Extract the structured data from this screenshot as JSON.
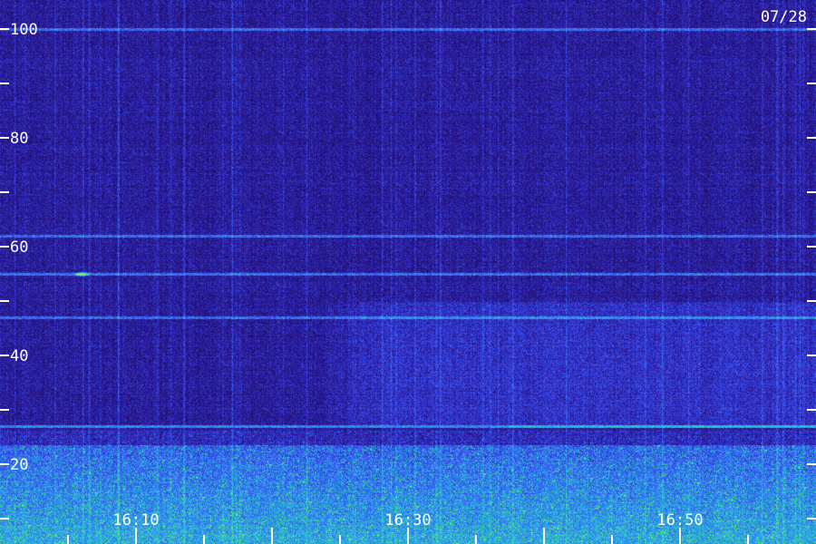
{
  "chart_data": {
    "type": "heatmap",
    "title": "",
    "date_label": "07/28",
    "xlabel": "",
    "ylabel": "",
    "x_axis": {
      "unit": "time (HH:MM)",
      "range": [
        "16:00",
        "16:60"
      ],
      "major_ticks": [
        "16:10",
        "16:30",
        "16:50"
      ],
      "minor_tick_interval_minutes": 5
    },
    "y_axis": {
      "range": [
        5,
        100
      ],
      "major_ticks": [
        {
          "value": 100,
          "label": "100"
        },
        {
          "value": 80,
          "label": "80"
        },
        {
          "value": 60,
          "label": "60"
        },
        {
          "value": 40,
          "label": "40"
        },
        {
          "value": 20,
          "label": "20"
        }
      ],
      "minor_ticks": [
        90,
        70,
        50,
        30,
        10
      ]
    },
    "colormap": [
      "#12062e",
      "#1c0b55",
      "#2a1a9a",
      "#3a4cf0",
      "#2c9bf0",
      "#28d8b0",
      "#7cf060"
    ],
    "features": {
      "strong_band": {
        "y_range": [
          5,
          27
        ],
        "description_level": "high"
      },
      "steady_line_y": 27,
      "faint_lines_y": [
        100,
        62,
        55,
        47
      ],
      "bright_spot": {
        "time": "16:06",
        "y": 55
      },
      "enhanced_region": {
        "time_range": [
          "16:23",
          "16:60"
        ],
        "y_range": [
          27,
          50
        ]
      }
    },
    "grid": false,
    "legend": "none"
  },
  "colors": {
    "background": "#17093f",
    "label": "#ffffff"
  }
}
